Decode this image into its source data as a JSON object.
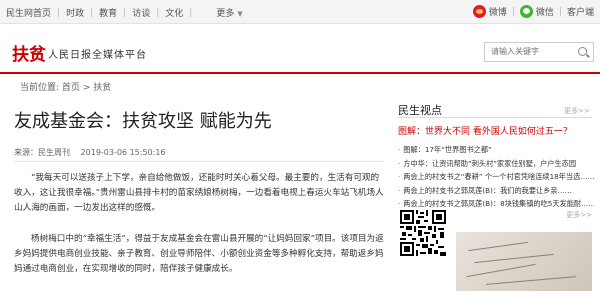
{
  "topbar": {
    "nav": [
      "民生网首页",
      "时政",
      "教育",
      "访谈",
      "文化"
    ],
    "more": "更多",
    "weibo": "微博",
    "weixin": "微信",
    "client": "客户端"
  },
  "logo": {
    "title": "扶贫",
    "subtitle": "人民日报全媒体平台"
  },
  "search": {
    "placeholder": "请输入关键字"
  },
  "breadcrumb": {
    "prefix": "当前位置:",
    "home": "首页",
    "sep": ">",
    "section": "扶贫"
  },
  "article": {
    "title": "友成基金会：扶贫攻坚 赋能为先",
    "source": "来源：民生周刊",
    "date": "2019-03-06 15:50:16",
    "paragraphs": [
      "“我每天可以送孩子上下学，亲自给他做饭，还能时时关心着父母。最主要的，生活有可观的收入，这让我很幸福。”贵州雷山县排卡村的苗家绣娘杨树梅，一边看着电视上春运火车站飞机场人山人海的画面，一边发出这样的感慨。",
      "杨树梅口中的“幸福生活”，得益于友成基金会在雷山县开展的“让妈妈回家”项目。该项目为返乡妈妈提供电商创业技能、亲子教育、创业导师陪伴、小额创业资金等多种孵化支持，帮助返乡妈妈通过电商创业，在实现增收的同时，陪伴孩子健康成长。"
    ]
  },
  "sidebar": {
    "title": "民生视点",
    "more": "更多>>",
    "headline": "图解：世界大不同 看外国人民如何过五一？",
    "items": [
      "图解：17年“世界图书之都”",
      "方中华：让资讯帮助“刺头村”家家住别墅，户户生态园",
      "两会上的村支书之“春耕” 个一个村官凭啥连续18年当选……",
      "两会上的村支书之郭凤莲(B)：我们的我要让乡亲……",
      "两会上的村支书之郭凤莲(B)：8块钱集镇的吃5天发能耐……",
      "两会上的村支书之“主题：“猪坐镇”的穷村，他这样找到幸福"
    ],
    "photo_more": "更多>>"
  }
}
